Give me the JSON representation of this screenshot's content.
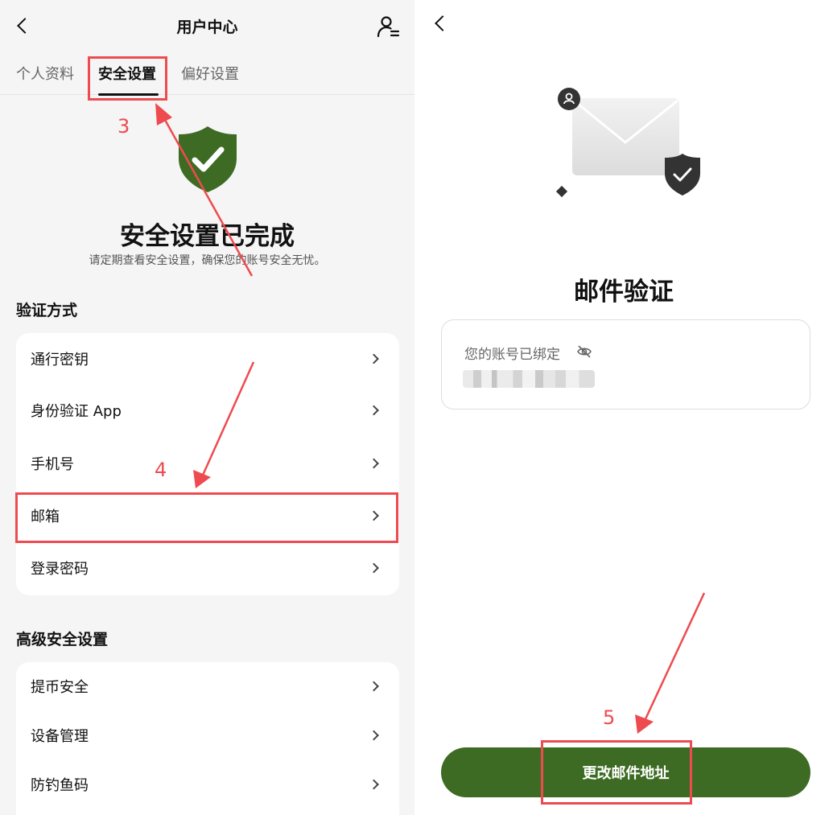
{
  "left_panel": {
    "header": {
      "title": "用户中心",
      "back_icon": "chevron-left-icon",
      "menu_icon": "user-settings-icon"
    },
    "tabs": [
      {
        "label": "个人资料",
        "active": false
      },
      {
        "label": "安全设置",
        "active": true
      },
      {
        "label": "偏好设置",
        "active": false
      }
    ],
    "hero": {
      "icon": "shield-check-icon",
      "title": "安全设置已完成",
      "subtitle": "请定期查看安全设置，确保您的账号安全无忧。"
    },
    "verification": {
      "title": "验证方式",
      "items": [
        {
          "label": "通行密钥"
        },
        {
          "label": "身份验证 App"
        },
        {
          "label": "手机号"
        },
        {
          "label": "邮箱"
        },
        {
          "label": "登录密码"
        }
      ]
    },
    "advanced": {
      "title": "高级安全设置",
      "items": [
        {
          "label": "提币安全"
        },
        {
          "label": "设备管理"
        },
        {
          "label": "防钓鱼码"
        }
      ]
    }
  },
  "right_panel": {
    "back_icon": "chevron-left-icon",
    "illustration": "mail-shield-illustration",
    "title": "邮件验证",
    "bound_card": {
      "label": "您的账号已绑定",
      "visibility_icon": "eye-off-icon"
    },
    "primary_button": "更改邮件地址"
  },
  "annotations": {
    "color": "#ee4b50",
    "steps": [
      "3",
      "4",
      "5"
    ]
  },
  "colors": {
    "brand_green": "#3d6b23",
    "annotation_red": "#ee4b50",
    "panel_bg": "#f5f5f5"
  }
}
